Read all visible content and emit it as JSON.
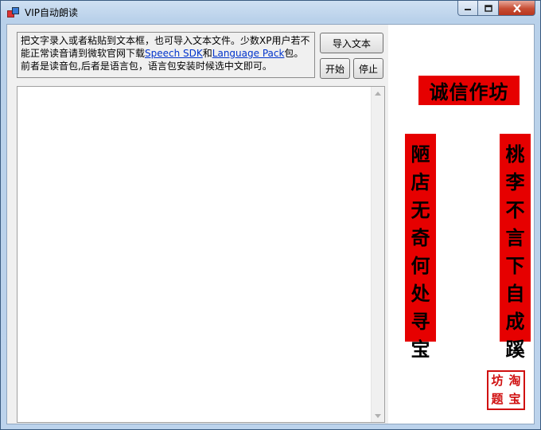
{
  "window": {
    "title": "VIP自动朗读"
  },
  "info": {
    "text_before_link1": "把文字录入或者粘贴到文本框，也可导入文本文件。少数XP用户若不能正常读音请到微软官网下载",
    "link1": "Speech SDK",
    "text_between": "和",
    "link2": "Language Pack",
    "text_after": "包。前者是读音包,后者是语言包，语言包安装时候选中文即可。"
  },
  "buttons": {
    "import": "导入文本",
    "start": "开始",
    "stop": "停止"
  },
  "textarea": {
    "value": ""
  },
  "decor": {
    "banner": "诚信作坊",
    "couplet_left": [
      "陋",
      "店",
      "无",
      "奇",
      "何",
      "处",
      "寻",
      "宝"
    ],
    "couplet_right": [
      "桃",
      "李",
      "不",
      "言",
      "下",
      "自",
      "成",
      "蹊"
    ],
    "seal": [
      "淘",
      "坊",
      "宝",
      "题"
    ]
  },
  "colors": {
    "red": "#e60000",
    "link": "#0033cc"
  }
}
